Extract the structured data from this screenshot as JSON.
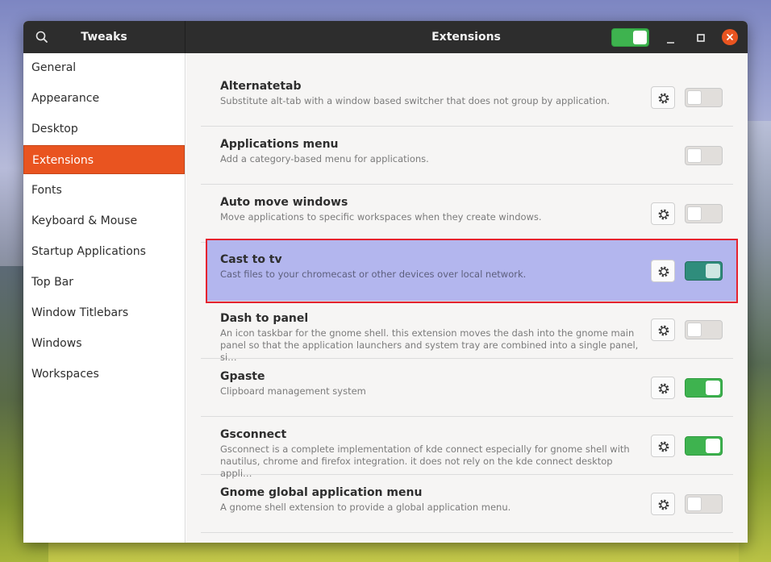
{
  "window": {
    "app_title": "Tweaks",
    "page_title": "Extensions",
    "global_extensions_enabled": true
  },
  "sidebar": {
    "items": [
      {
        "label": "General"
      },
      {
        "label": "Appearance"
      },
      {
        "label": "Desktop"
      },
      {
        "label": "Extensions",
        "selected": true
      },
      {
        "label": "Fonts"
      },
      {
        "label": "Keyboard & Mouse"
      },
      {
        "label": "Startup Applications"
      },
      {
        "label": "Top Bar"
      },
      {
        "label": "Window Titlebars"
      },
      {
        "label": "Windows"
      },
      {
        "label": "Workspaces"
      }
    ]
  },
  "extensions": [
    {
      "name": "Alternatetab",
      "description": "Substitute alt-tab with a window based switcher that does not group by application.",
      "has_settings": true,
      "enabled": false
    },
    {
      "name": "Applications menu",
      "description": "Add a category-based menu for applications.",
      "has_settings": false,
      "enabled": false
    },
    {
      "name": "Auto move windows",
      "description": "Move applications to specific workspaces when they create windows.",
      "has_settings": true,
      "enabled": false
    },
    {
      "name": "Cast to tv",
      "description": "Cast files to your chromecast or other devices over local network.",
      "has_settings": true,
      "enabled": true,
      "highlighted": true
    },
    {
      "name": "Dash to panel",
      "description": "An icon taskbar for the gnome shell. this extension moves the dash into the gnome main panel so that the application launchers and system tray are combined into a single panel, si…",
      "has_settings": true,
      "enabled": false
    },
    {
      "name": "Gpaste",
      "description": "Clipboard management system",
      "has_settings": true,
      "enabled": true
    },
    {
      "name": "Gsconnect",
      "description": "Gsconnect is a complete implementation of kde connect especially for gnome shell with nautilus, chrome and firefox integration. it does not rely on the kde connect desktop appli…",
      "has_settings": true,
      "enabled": true
    },
    {
      "name": "Gnome global application menu",
      "description": "A gnome shell extension to provide a global application menu.",
      "has_settings": true,
      "enabled": false
    }
  ],
  "colors": {
    "accent": "#e95420",
    "switch_on": "#3eb34f",
    "switch_on_highlighted": "#2f8d7c",
    "highlight_bg": "#b3b6ee",
    "highlight_border": "#e5232f"
  },
  "icons": {
    "search": "search-icon",
    "minimize": "minimize-icon",
    "maximize": "maximize-icon",
    "close": "close-icon",
    "settings": "gear-icon"
  }
}
